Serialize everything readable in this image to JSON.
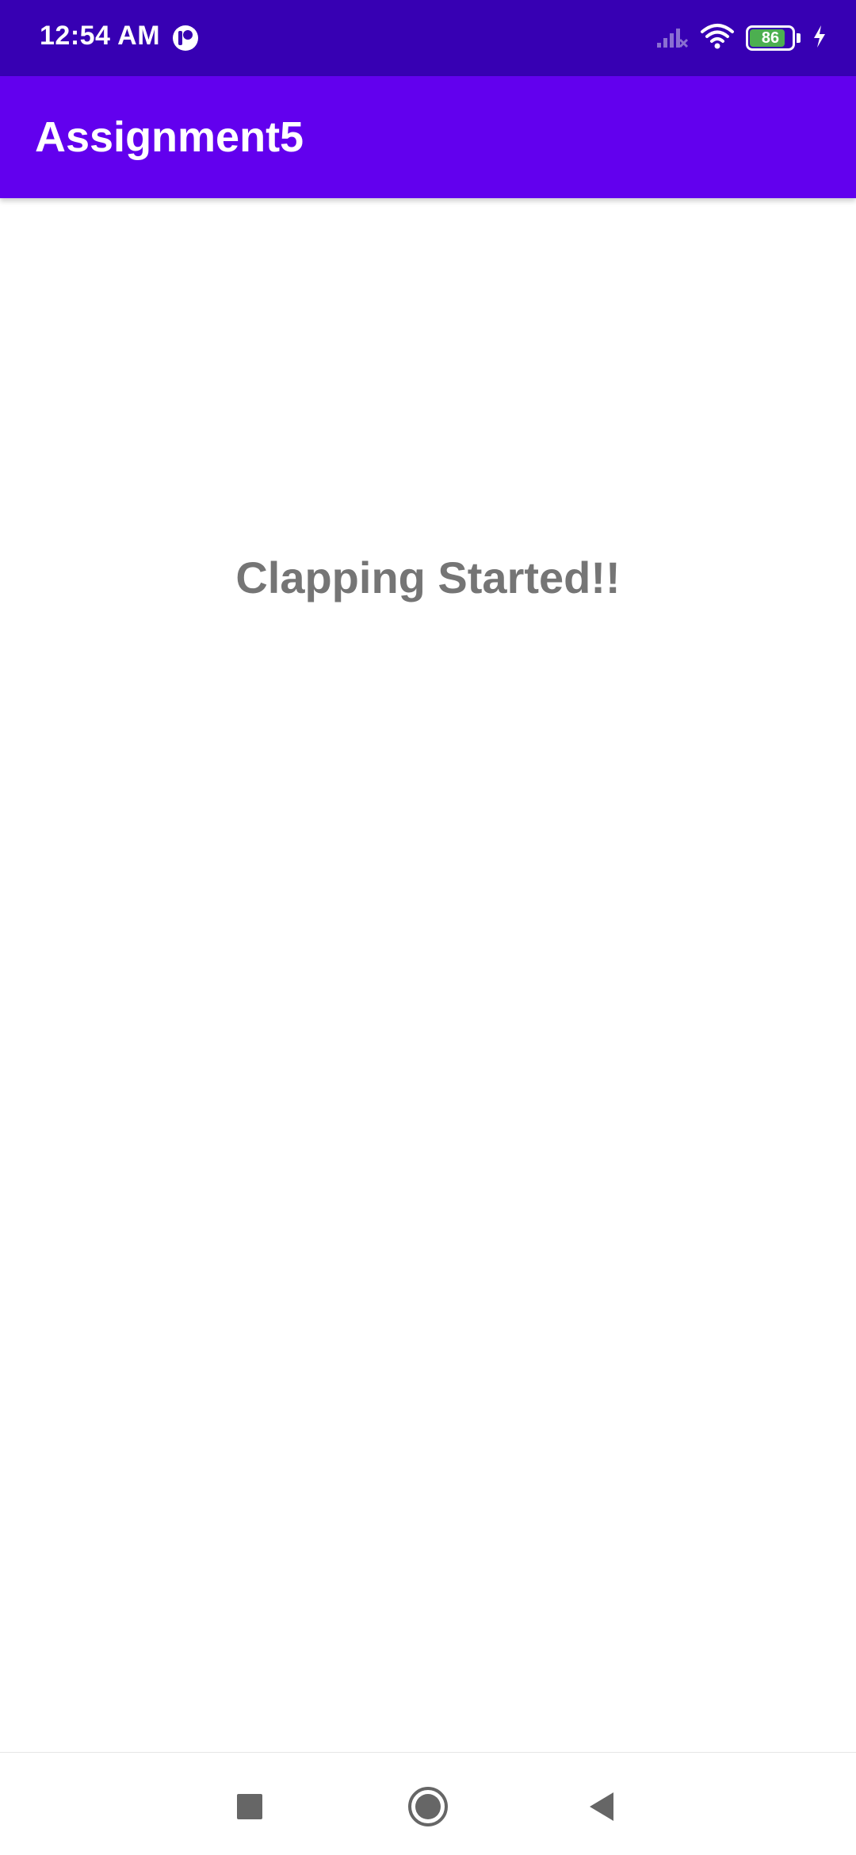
{
  "status_bar": {
    "time": "12:54 AM",
    "battery_level": "86",
    "battery_fraction": 0.86,
    "icons": [
      "app-notification-icon",
      "signal-off-icon",
      "wifi-icon",
      "battery-icon",
      "charging-bolt-icon"
    ]
  },
  "app_bar": {
    "title": "Assignment5"
  },
  "main": {
    "status_text": "Clapping Started!!"
  },
  "nav_bar": {
    "buttons": [
      "recents-button",
      "home-button",
      "back-button"
    ]
  },
  "colors": {
    "status_bar": "#3700b3",
    "app_bar": "#6200ee",
    "text_gray": "#757575",
    "battery_green": "#4caf50"
  }
}
